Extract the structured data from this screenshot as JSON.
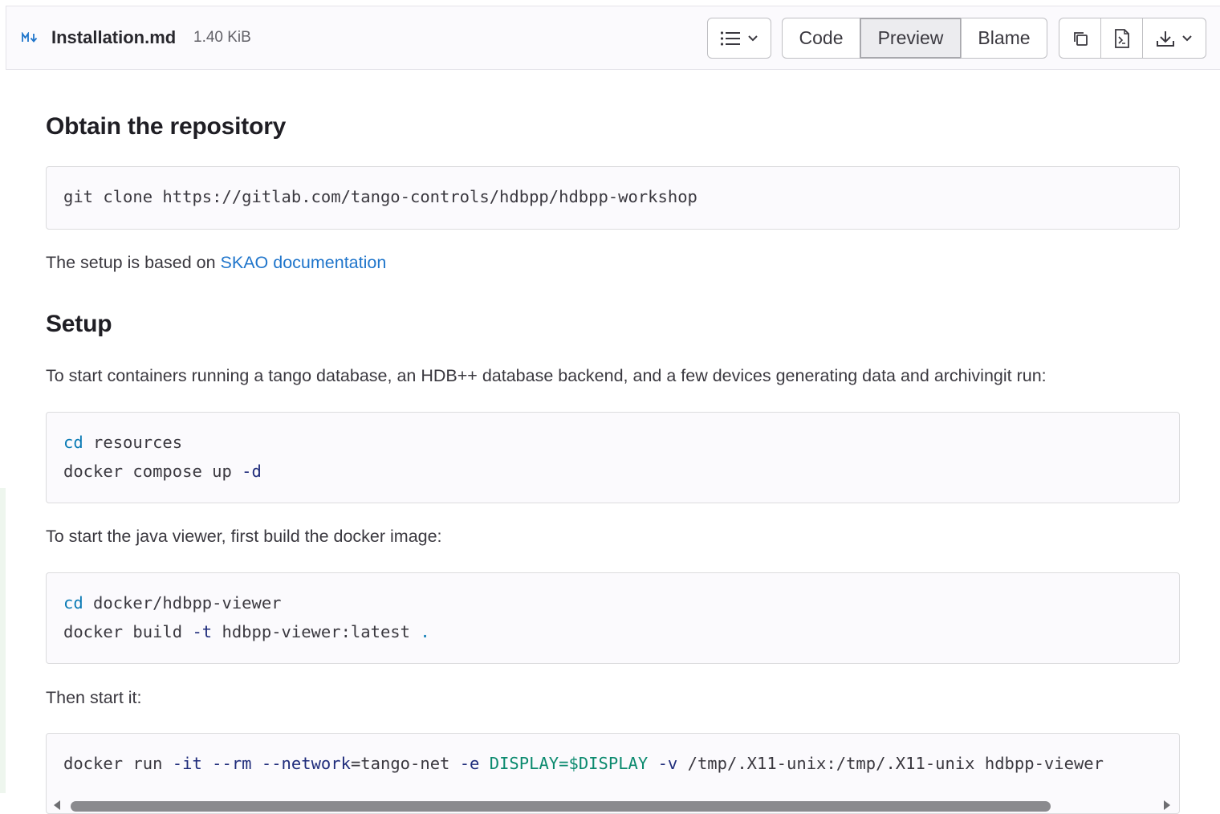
{
  "file": {
    "icon": "markdown-icon",
    "icon_text": "M↓",
    "name": "Installation.md",
    "size": "1.40 KiB"
  },
  "toolbar": {
    "toc_icon": "list-icon",
    "view_modes": [
      "Code",
      "Preview",
      "Blame"
    ],
    "active_mode": "Preview",
    "actions": [
      "copy-icon",
      "raw-file-icon",
      "download-icon"
    ]
  },
  "content": {
    "h_obtain": "Obtain the repository",
    "clone_cmd": "git clone https://gitlab.com/tango-controls/hdbpp/hdbpp-workshop",
    "setup_based_prefix": "The setup is based on ",
    "setup_based_link": "SKAO documentation",
    "h_setup": "Setup",
    "setup_desc": "To start containers running a tango database, an HDB++ database backend, and a few devices generating data and archivingit run:",
    "block2": {
      "l1_kw": "cd",
      "l1_rest": " resources",
      "l2_a": "docker compose up ",
      "l2_flag": "-d"
    },
    "viewer_desc": "To start the java viewer, first build the docker image:",
    "block3": {
      "l1_kw": "cd",
      "l1_rest": " docker/hdbpp-viewer",
      "l2_a": "docker build ",
      "l2_flag": "-t",
      "l2_b": " hdbpp-viewer:latest ",
      "l2_dot": "."
    },
    "then_start": "Then start it:",
    "block4": {
      "a": "docker run ",
      "f1": "-it",
      "sp1": " ",
      "f2": "--rm",
      "sp2": " ",
      "f3": "--network",
      "b": "=tango-net ",
      "f4": "-e",
      "sp3": " ",
      "v1": "DISPLAY=$DISPLAY",
      "sp4": " ",
      "f5": "-v",
      "c": " /tmp/.X11-unix:/tmp/.X11-unix hdbpp-viewer"
    }
  },
  "colors": {
    "link": "#1f75cb",
    "keyword": "#0b7bb5",
    "flag": "#1f2c7b",
    "variable": "#0b8a6e"
  }
}
